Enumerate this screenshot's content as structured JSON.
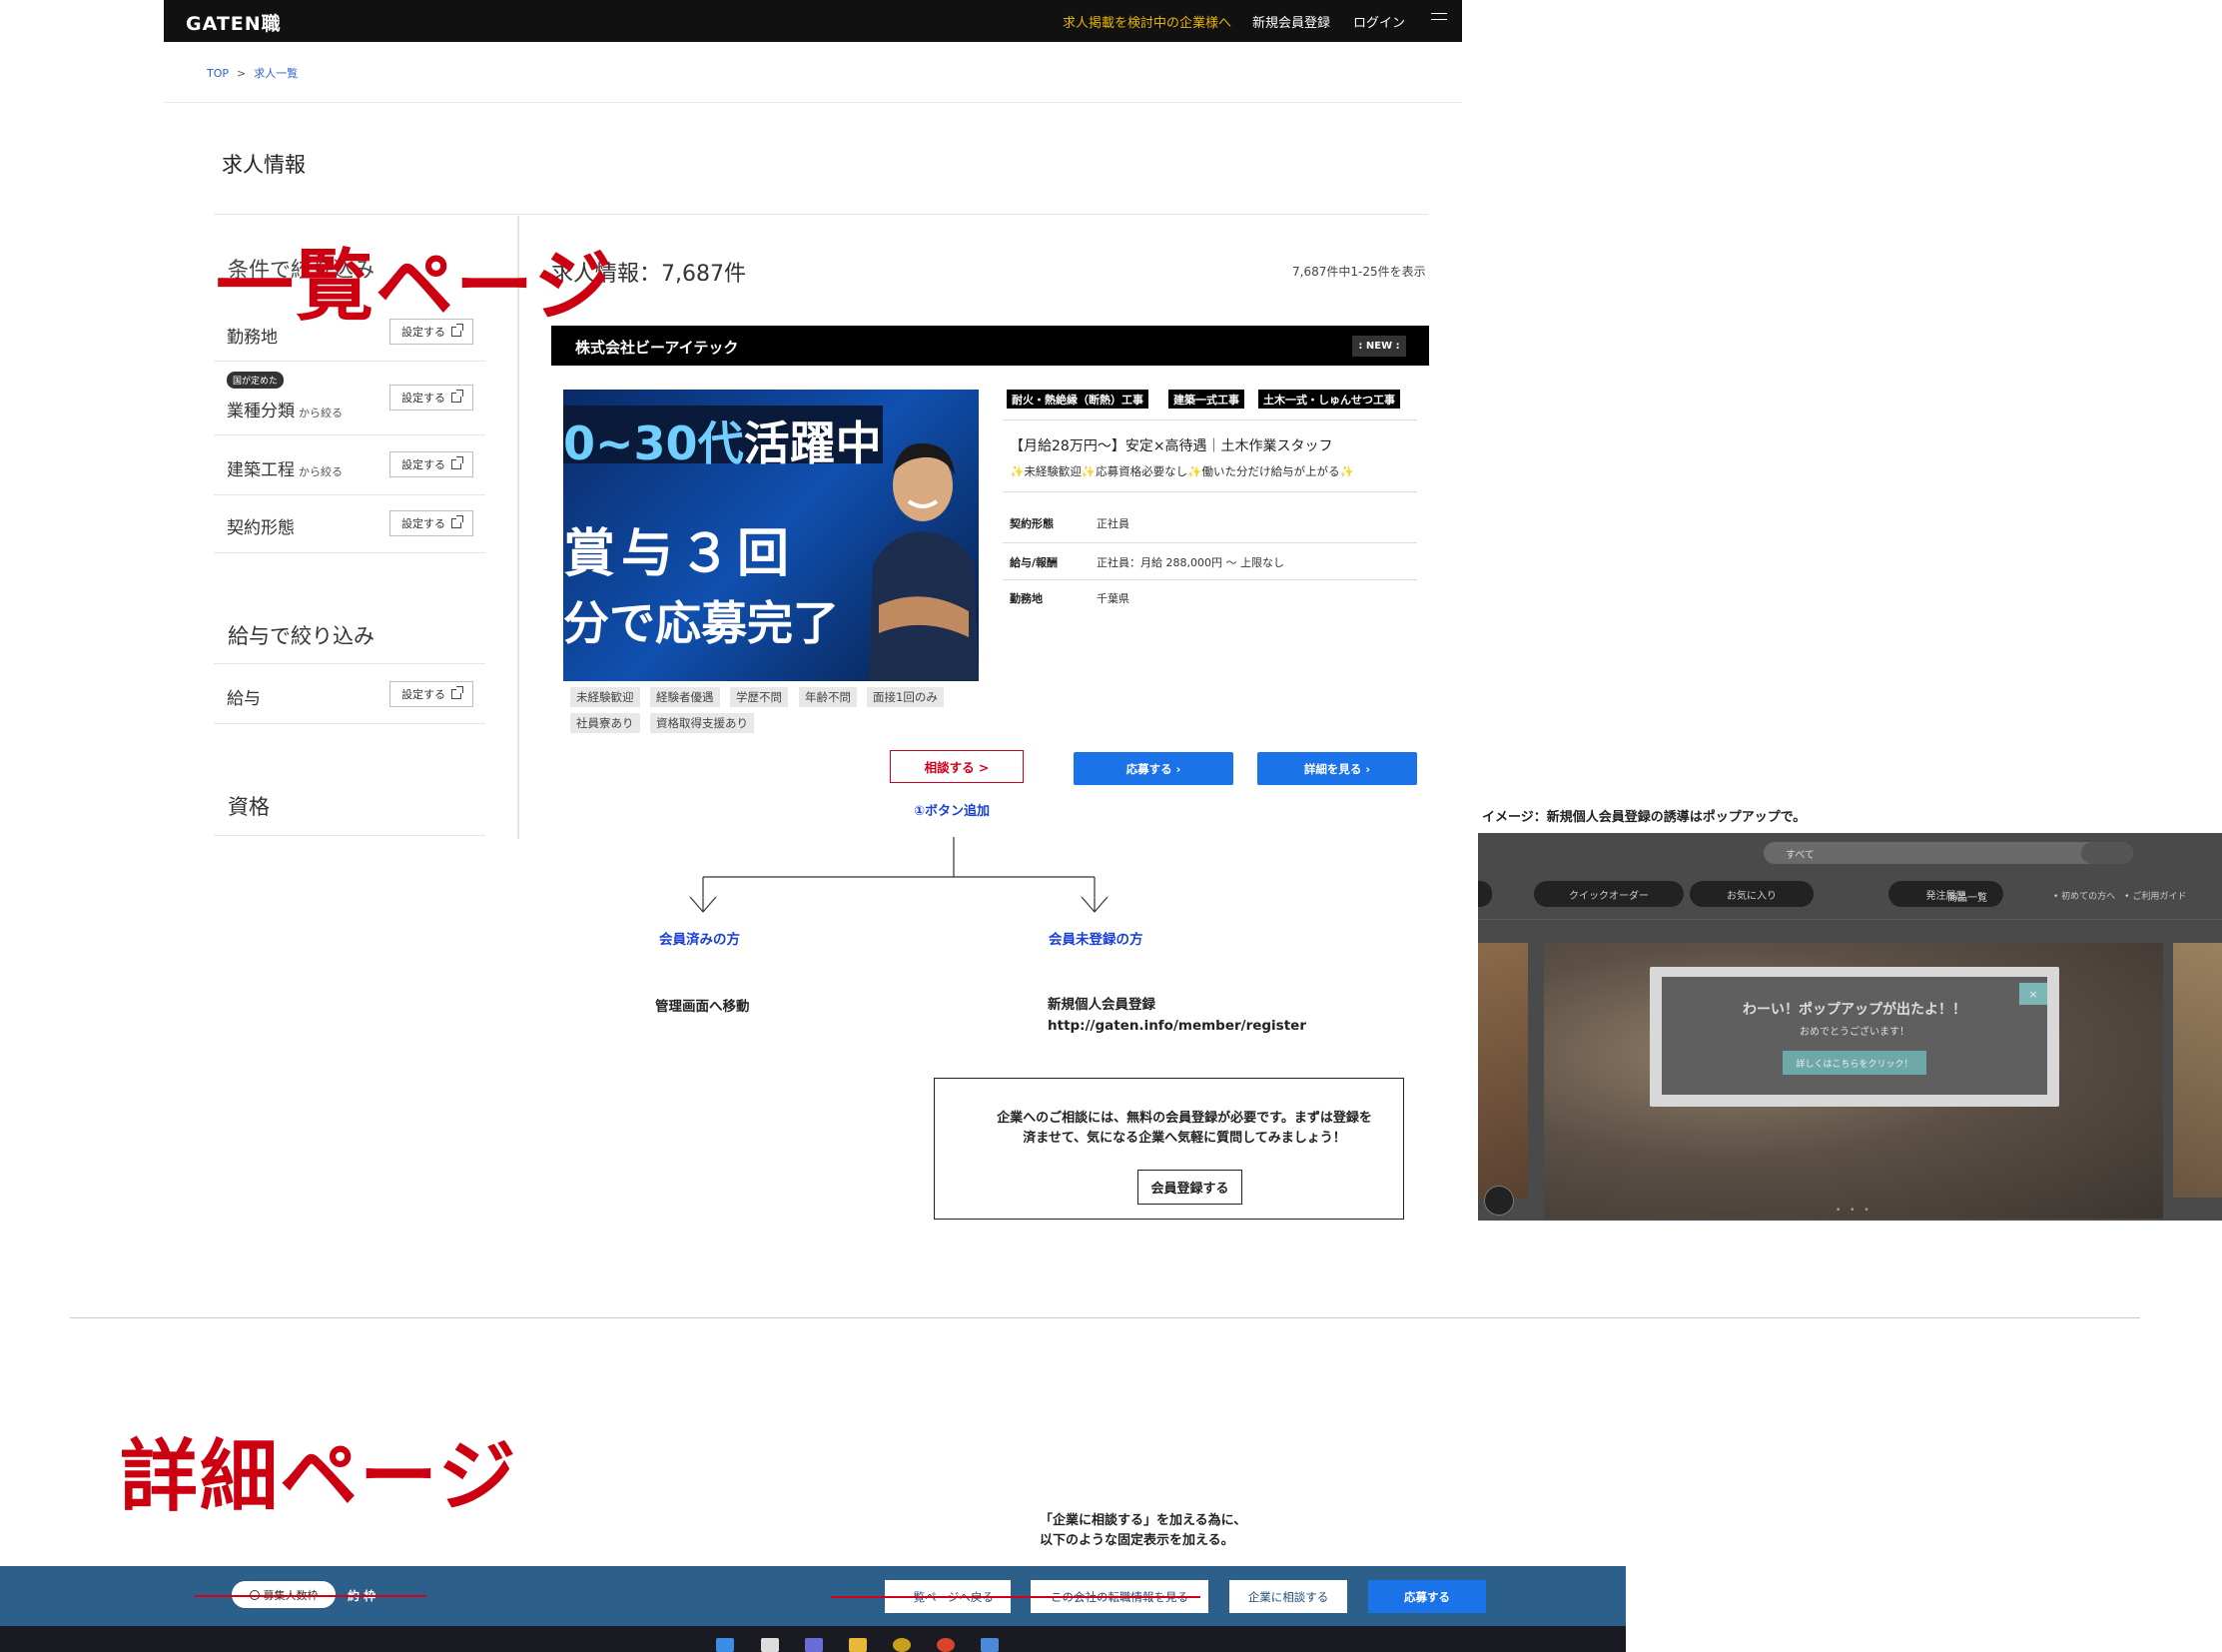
{
  "header": {
    "logo": "GATEN職",
    "corp_link": "求人掲載を検討中の企業様へ",
    "register": "新規会員登録",
    "login": "ログイン"
  },
  "breadcrumb": [
    "TOP",
    ">",
    "求人一覧"
  ],
  "page_title": "求人情報",
  "overlay_list": "一覧ページ",
  "sidebar": {
    "filter_title": "条件で絞り込み",
    "set_label": "設定する",
    "filters": [
      {
        "label": "勤務地",
        "sub": ""
      },
      {
        "label": "業種分類",
        "sub": "から絞る",
        "badge": "国が定めた"
      },
      {
        "label": "建築工程",
        "sub": "から絞る"
      },
      {
        "label": "契約形態",
        "sub": ""
      }
    ],
    "salary_title": "給与で絞り込み",
    "salary_label": "給与",
    "qual_title": "資格"
  },
  "results": {
    "count_title": "求人情報：7,687件",
    "count_range": "7,687件中1-25件を表示"
  },
  "job": {
    "company": "株式会社ビーアイテック",
    "new_badge": ": NEW :",
    "image_text": {
      "line1_a": "0~30代",
      "line1_b": "活躍中",
      "line2": "賞与３回",
      "line3": "分で応募完了"
    },
    "tags": [
      "耐火・熱絶縁（断熱）工事",
      "建築一式工事",
      "土木一式・しゅんせつ工事"
    ],
    "title": "【月給28万円〜】安定×高待遇｜土木作業スタッフ",
    "subtitle_parts": [
      "未経験歓迎",
      "応募資格必要なし",
      "働いた分だけ給与が上がる"
    ],
    "star": "✨",
    "details": [
      {
        "k": "契約形態",
        "v": "正社員"
      },
      {
        "k": "給与/報酬",
        "v": "正社員：月給 288,000円 〜 上限なし"
      },
      {
        "k": "勤務地",
        "v": "千葉県"
      }
    ],
    "chips_row1": [
      "未経験歓迎",
      "経験者優遇",
      "学歴不問",
      "年齢不問",
      "面接1回のみ"
    ],
    "chips_row2": [
      "社員寮あり",
      "資格取得支援あり"
    ],
    "consult_btn": "相談する >",
    "apply_btn": "応募する ›",
    "detail_btn": "詳細を見る ›"
  },
  "flow": {
    "note_add": "①ボタン追加",
    "member": "会員済みの方",
    "nonmember": "会員未登録の方",
    "member_action": "管理画面へ移動",
    "register_title": "新規個人会員登録",
    "register_url": "http://gaten.info/member/register",
    "box_message": "企業へのご相談には、無料の会員登録が必要です。まずは登録を済ませて、気になる企業へ気軽に質問してみましょう！",
    "box_button": "会員登録する"
  },
  "popup_example": {
    "caption": "イメージ：新規個人会員登録の誘導はポップアップで。",
    "search_all": "すべて",
    "pills": [
      "クイックオーダー",
      "お気に入り",
      "発注履歴"
    ],
    "category": "商品一覧",
    "links": "• 初めての方へ　• ご利用ガイド",
    "modal_title": "わーい！ポップアップが出たよ！！",
    "modal_sub": "おめでとうございます！",
    "modal_button": "詳しくはこちらをクリック！",
    "close": "×",
    "dots": "• • •"
  },
  "detail_section": {
    "overlay": "詳細ページ",
    "note_line1": "「企業に相談する」を加える為に、",
    "note_line2": "以下のような固定表示を加える。"
  },
  "fixed_bar": {
    "pill": "募集人数枠",
    "count": "約 枠",
    "back_btn": "一覧ページへ戻る",
    "company_btn": "この会社の転職情報を見る",
    "consult_btn": "企業に相談する",
    "apply_btn": "応募する"
  },
  "colors": {
    "accent_red": "#cc0010",
    "link_blue": "#1a3fd8",
    "button_blue": "#1a73e8",
    "bar_blue": "#2c5f8a"
  }
}
